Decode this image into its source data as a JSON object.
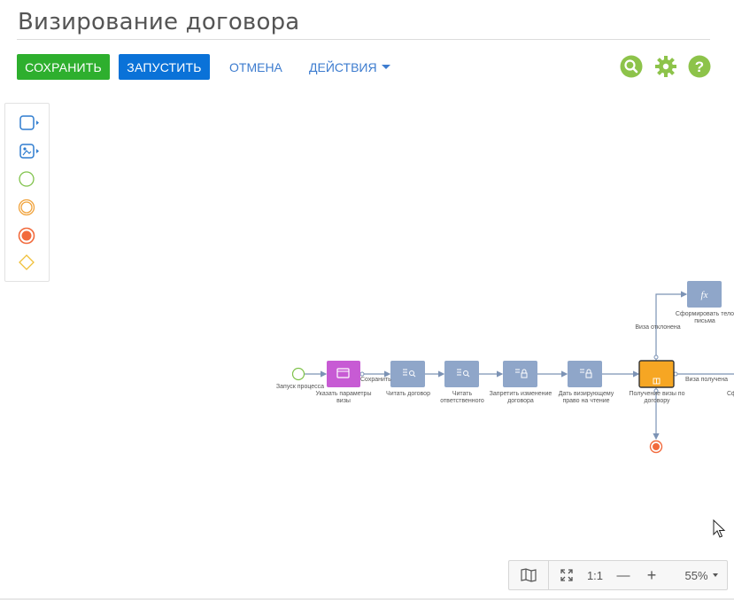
{
  "page": {
    "title": "Визирование договора"
  },
  "toolbar": {
    "save_label": "СОХРАНИТЬ",
    "run_label": "ЗАПУСТИТЬ",
    "cancel_label": "ОТМЕНА",
    "actions_label": "ДЕЙСТВИЯ"
  },
  "tools": [
    "search-icon",
    "gear-icon",
    "help-icon"
  ],
  "palette": [
    "task-icon",
    "user-task-icon",
    "start-event-icon",
    "intermediate-event-icon",
    "end-event-icon",
    "gateway-icon"
  ],
  "diagram": {
    "start_label": "Запуск процесса",
    "step1": "Указать параметры визы",
    "flow1": "Сохранить",
    "step2": "Читать договор",
    "step3": "Читать ответственного",
    "step4": "Запретить изменение договора",
    "step5": "Дать визирующему право на чтение",
    "step6": "Получение визы по договору",
    "flow_rejected": "Виза отклонена",
    "step7": "Сформировать тело письма",
    "flow_received": "Виза получена",
    "partial_label": "Сф"
  },
  "zoom": {
    "ratio_label": "1:1",
    "minus": "—",
    "plus": "+",
    "level": "55%"
  },
  "colors": {
    "green": "#2eaf2e",
    "blue": "#0a72d8",
    "task": "#8fa6c9",
    "purple": "#c75bd4",
    "orange": "#f6a623",
    "end": "#f26a3c"
  }
}
